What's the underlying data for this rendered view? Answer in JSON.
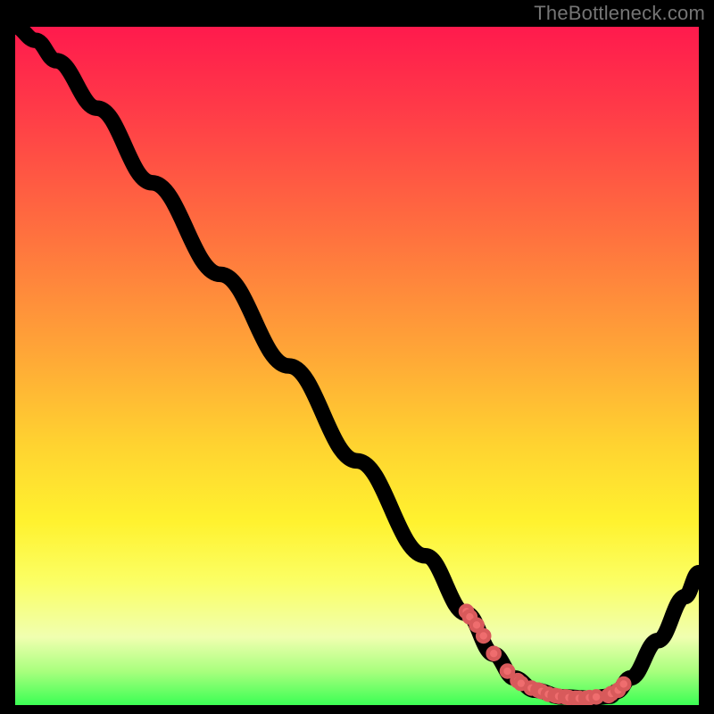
{
  "watermark": "TheBottleneck.com",
  "chart_data": {
    "type": "line",
    "title": "",
    "xlabel": "",
    "ylabel": "",
    "xlim": [
      0,
      100
    ],
    "ylim": [
      0,
      100
    ],
    "grid": false,
    "legend": false,
    "background_gradient": [
      "#ff1a4d",
      "#ff6f3f",
      "#ffd430",
      "#fff22f",
      "#3bff54"
    ],
    "series": [
      {
        "name": "bottleneck-curve",
        "color": "#000000",
        "x": [
          0,
          3,
          6,
          12,
          20,
          30,
          40,
          50,
          60,
          66,
          70,
          73,
          76,
          80,
          84,
          87,
          88,
          90,
          94,
          98,
          100
        ],
        "values": [
          100,
          98,
          95,
          88,
          77,
          63.5,
          50,
          36,
          22,
          13.5,
          7.5,
          4,
          2.2,
          1.2,
          1.0,
          1.3,
          2.0,
          4.0,
          9.5,
          16,
          19.5
        ]
      }
    ],
    "scatter_points": {
      "name": "optimum-markers",
      "color": "#ef6d6e",
      "x": [
        66.0,
        66.5,
        67.5,
        68.5,
        70.0,
        72.0,
        73.5,
        74.0,
        75.5,
        76.5,
        77.0,
        78.0,
        79.0,
        79.5,
        80.5,
        81.0,
        82.0,
        82.5,
        83.5,
        84.0,
        85.0,
        86.8,
        87.2,
        88.2,
        89.0
      ],
      "values": [
        13.8,
        13.0,
        11.8,
        10.2,
        7.6,
        5.0,
        3.6,
        3.2,
        2.5,
        2.2,
        2.0,
        1.6,
        1.4,
        1.3,
        1.2,
        1.1,
        1.0,
        1.0,
        1.0,
        1.1,
        1.2,
        1.4,
        1.7,
        2.2,
        3.1
      ]
    }
  }
}
